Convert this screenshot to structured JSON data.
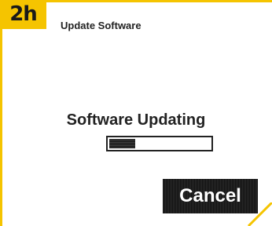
{
  "step": {
    "label": "2h"
  },
  "header": {
    "title": "Update Software"
  },
  "status": {
    "text": "Software Updating"
  },
  "progress": {
    "fraction": 0.26
  },
  "actions": {
    "cancel_label": "Cancel"
  },
  "colors": {
    "accent": "#f5c400",
    "text": "#222222",
    "button_bg": "#111111",
    "button_text": "#ffffff"
  }
}
